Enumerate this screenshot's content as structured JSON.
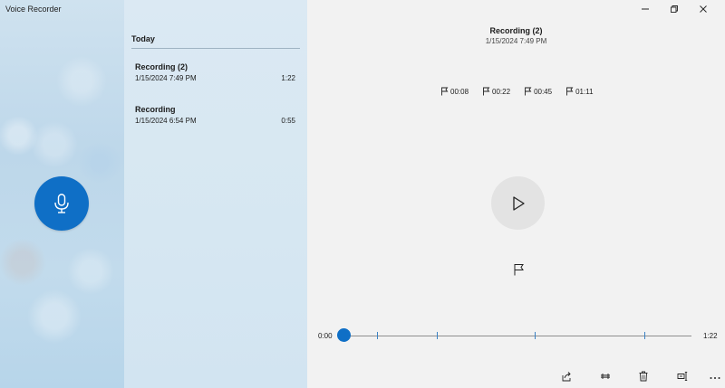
{
  "app": {
    "title": "Voice Recorder"
  },
  "list": {
    "group_header": "Today",
    "recordings": [
      {
        "name": "Recording (2)",
        "date": "1/15/2024 7:49 PM",
        "duration": "1:22"
      },
      {
        "name": "Recording",
        "date": "1/15/2024 6:54 PM",
        "duration": "0:55"
      }
    ]
  },
  "player": {
    "title": "Recording (2)",
    "date": "1/15/2024 7:49 PM",
    "markers": [
      "00:08",
      "00:22",
      "00:45",
      "01:11"
    ],
    "time_start": "0:00",
    "time_end": "1:22",
    "position": 0,
    "duration_seconds": 82,
    "marker_seconds": [
      8,
      22,
      45,
      71
    ]
  },
  "colors": {
    "accent": "#0f6fc6"
  },
  "icons": {
    "record": "microphone-icon",
    "play": "play-icon",
    "marker": "flag-icon",
    "share": "share-icon",
    "trim": "trim-icon",
    "delete": "trash-icon",
    "rename": "rename-icon",
    "more": "more-icon"
  }
}
